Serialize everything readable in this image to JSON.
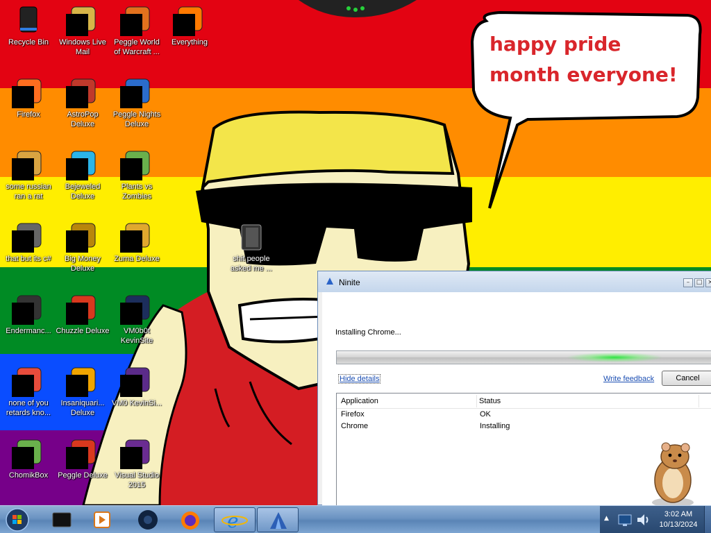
{
  "wallpaper": {
    "speech_bubble_text": "happy pride month everyone!"
  },
  "desktop": {
    "icons": [
      {
        "label": "Recycle Bin",
        "icon": "recycle-bin-icon"
      },
      {
        "label": "Windows Live Mail",
        "icon": "mail-icon"
      },
      {
        "label": "Peggle World of Warcraft ...",
        "icon": "game-icon"
      },
      {
        "label": "Everything",
        "icon": "search-icon"
      },
      {
        "label": "Firefox",
        "icon": "firefox-icon"
      },
      {
        "label": "AstroPop Deluxe",
        "icon": "game-icon"
      },
      {
        "label": "Peggle Nights Deluxe",
        "icon": "game-icon"
      },
      {
        "label": "some russian ran a rat",
        "icon": "app-icon"
      },
      {
        "label": "Bejeweled Deluxe",
        "icon": "gem-icon"
      },
      {
        "label": "Plants vs Zombies",
        "icon": "plant-icon"
      },
      {
        "label": "that but its c#",
        "icon": "window-icon"
      },
      {
        "label": "Big Money Deluxe",
        "icon": "money-bag-icon"
      },
      {
        "label": "Zuma Deluxe",
        "icon": "game-icon"
      },
      {
        "label": "Endermanc...",
        "icon": "terminal-icon"
      },
      {
        "label": "Chuzzle Deluxe",
        "icon": "game-icon"
      },
      {
        "label": "VM0b0t KevinSite",
        "icon": "app-icon"
      },
      {
        "label": "none of you retards kno...",
        "icon": "app-icon"
      },
      {
        "label": "Insaniquari... Deluxe",
        "icon": "game-icon"
      },
      {
        "label": "VM0 KevinSi...",
        "icon": "app-icon"
      },
      {
        "label": "ChomikBox",
        "icon": "hamster-icon"
      },
      {
        "label": "Peggle Deluxe",
        "icon": "game-icon"
      },
      {
        "label": "Visual Studio 2015",
        "icon": "visual-studio-icon"
      },
      {
        "label": "shit people asked me ...",
        "icon": "folder-icon"
      }
    ]
  },
  "ninite": {
    "title": "Ninite",
    "status": "Installing Chrome...",
    "progress": 0.75,
    "hide_details": "Hide details",
    "write_feedback": "Write feedback",
    "cancel": "Cancel",
    "columns": [
      "Application",
      "Status"
    ],
    "rows": [
      {
        "application": "Firefox",
        "status": "OK"
      },
      {
        "application": "Chrome",
        "status": "Installing"
      }
    ]
  },
  "taskbar": {
    "items": [
      "start-orb",
      "window-switcher-icon",
      "media-player-icon",
      "steam-icon",
      "firefox-icon",
      "internet-explorer-icon",
      "ninite-icon"
    ],
    "clock_time": "3:02 AM",
    "clock_date": "10/13/2024"
  }
}
